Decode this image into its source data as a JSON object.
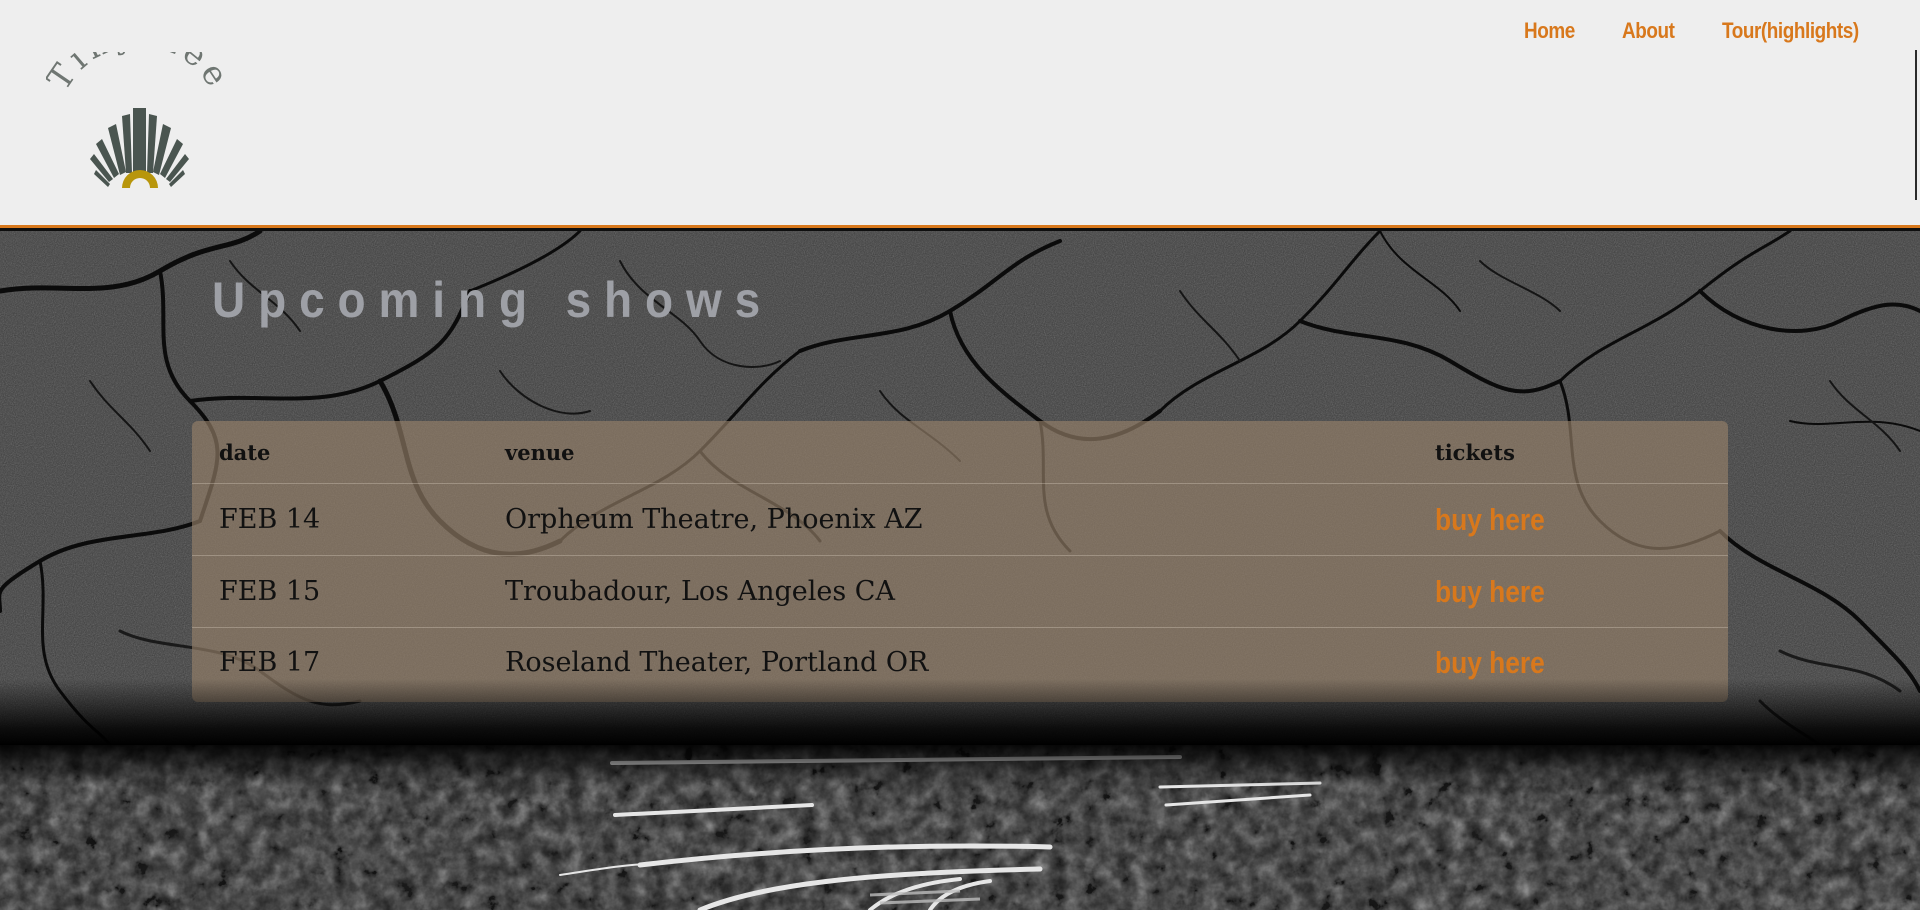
{
  "brand": {
    "logo_text": "Tiny Lee",
    "colors": {
      "accent": "#d8781c",
      "logo_gray": "#4a5550",
      "logo_gold": "#b8960c"
    }
  },
  "nav": {
    "items": [
      {
        "label": "Home"
      },
      {
        "label": "About"
      },
      {
        "label": "Tour(highlights)"
      }
    ]
  },
  "shows": {
    "title": "Upcoming shows",
    "columns": {
      "date": "date",
      "venue": "venue",
      "tickets": "tickets"
    },
    "rows": [
      {
        "date": "FEB 14",
        "venue": "Orpheum Theatre, Phoenix AZ",
        "ticket_label": "buy here"
      },
      {
        "date": "FEB 15",
        "venue": "Troubadour, Los Angeles CA",
        "ticket_label": "buy here"
      },
      {
        "date": "FEB 17",
        "venue": "Roseland Theater, Portland OR",
        "ticket_label": "buy here"
      }
    ]
  },
  "images": {
    "background": "cracked-earth-texture",
    "banner": "railway-tracks-photo"
  }
}
